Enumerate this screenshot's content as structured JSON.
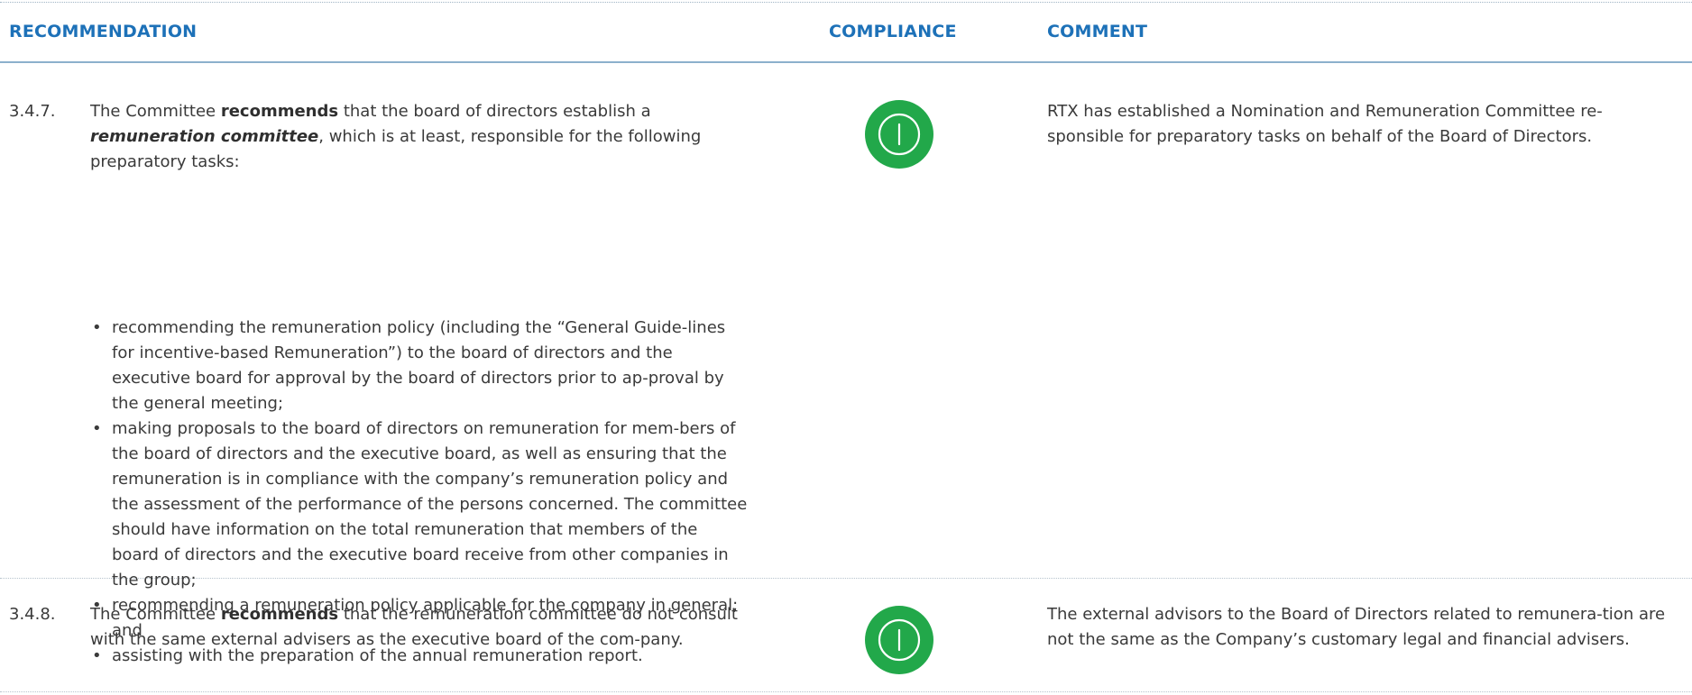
{
  "header": {
    "recommendation": "RECOMMENDATION",
    "compliance": "COMPLIANCE",
    "comment": "COMMENT"
  },
  "colors": {
    "header_text": "#1d71b8",
    "compliance_green": "#22a84a",
    "body_text": "#3a3a3a"
  },
  "rows": [
    {
      "number": "3.4.7.",
      "text": {
        "part1": "The Committee ",
        "bold": "recommends",
        "part2": " that the board of directors establish a",
        "bold_italic": "remuneration committee",
        "part3": ", which is at least, responsible for the following preparatory tasks:"
      },
      "bullets": [
        "recommending the remuneration policy (including the “General Guide-lines for incentive-based Remuneration”) to the board of directors and the executive board for approval by the board of directors prior to ap-proval by the general meeting;",
        "making proposals to the board of directors on remuneration for mem-bers of the board of directors and the executive board, as well as ensuring that the remuneration is in compliance with the company’s remuneration policy and the assessment of the performance of the persons concerned. The committee should have information on the total remuneration that members of the board of directors and the executive board receive from other companies in the group;",
        "recommending a remuneration policy applicable for the company in general; and",
        "assisting with the preparation of the annual remuneration report."
      ],
      "bullet_glyph": "•",
      "compliance_icon": "complied-icon",
      "comment": "RTX has established a Nomination and Remuneration Committee re-sponsible for preparatory tasks on behalf of the Board of Directors."
    },
    {
      "number": "3.4.8.",
      "text": {
        "part1": "The Committee ",
        "bold": "recommends",
        "part2": " that the remuneration committee do not consult with the same external advisers as the executive board of the com-pany."
      },
      "compliance_icon": "complied-icon",
      "comment": "The external advisors to the Board of Directors related to remunera-tion are not the same as the Company’s customary legal and financial advisers."
    }
  ]
}
